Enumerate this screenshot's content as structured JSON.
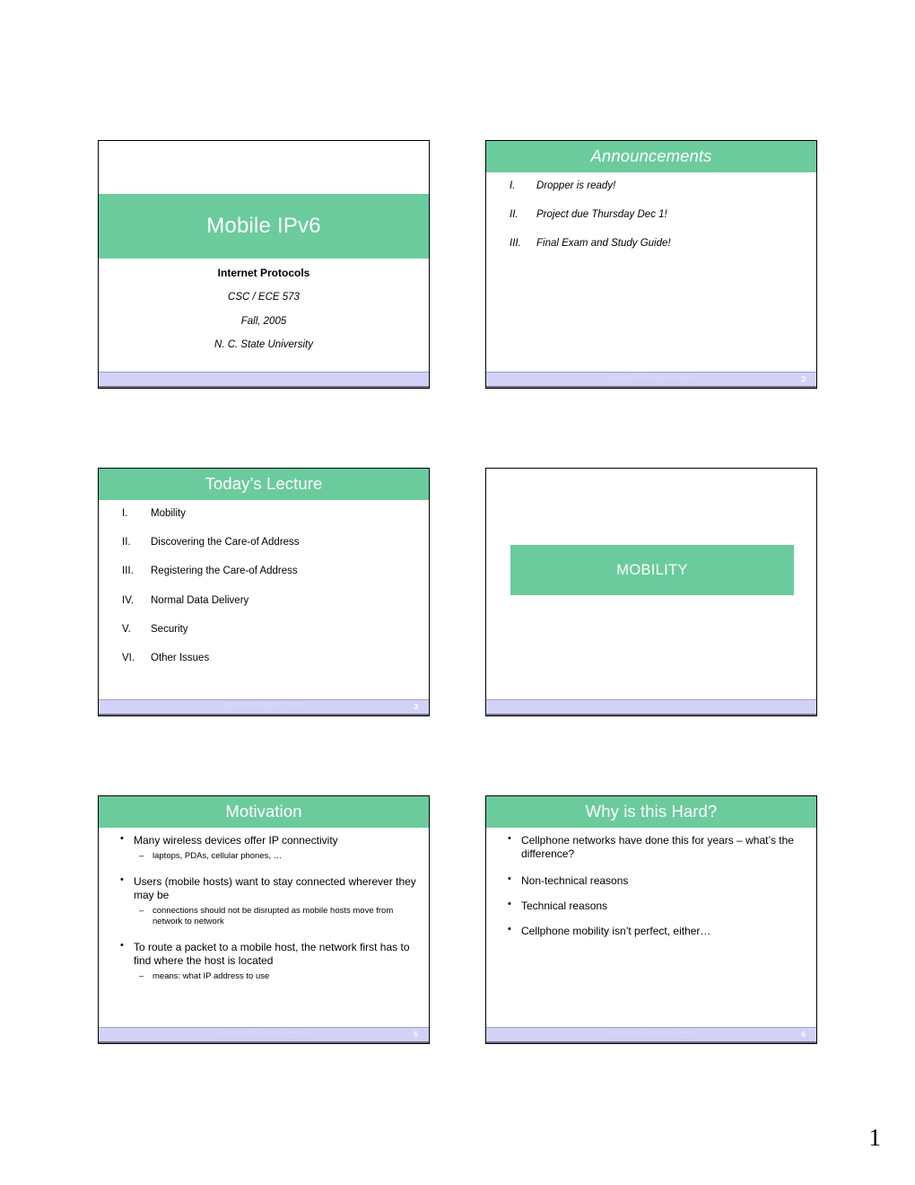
{
  "document": {
    "sheet_page_number": "1",
    "footer_copyright": "copyright 2005 Douglas S. Reeves",
    "accent_green": "#6BCB9D",
    "footer_bar_color": "#D2D2F7"
  },
  "slides": [
    {
      "id": "title-slide",
      "kind": "title",
      "band_title": "Mobile IPv6",
      "sub_lines": [
        "Internet Protocols",
        "CSC / ECE 573",
        "Fall, 2005",
        "N. C. State University"
      ],
      "footer": {
        "copyright": "",
        "page": ""
      }
    },
    {
      "id": "announcements-slide",
      "kind": "roman",
      "title": "Announcements",
      "items": [
        {
          "num": "I.",
          "text": "Dropper is ready!"
        },
        {
          "num": "II.",
          "text": "Project due Thursday Dec 1!"
        },
        {
          "num": "III.",
          "text": "Final Exam and Study Guide!"
        }
      ],
      "footer": {
        "copyright": "copyright 2005 Douglas S. Reeves",
        "page": "2"
      }
    },
    {
      "id": "todays-lecture-slide",
      "kind": "roman",
      "title": "Today’s Lecture",
      "items": [
        {
          "num": "I.",
          "text": "Mobility"
        },
        {
          "num": "II.",
          "text": "Discovering the Care-of Address"
        },
        {
          "num": "III.",
          "text": "Registering the Care-of Address"
        },
        {
          "num": "IV.",
          "text": "Normal Data Delivery"
        },
        {
          "num": "V.",
          "text": "Security"
        },
        {
          "num": "VI.",
          "text": "Other Issues"
        }
      ],
      "footer": {
        "copyright": "copyright 2005 Douglas S. Reeves",
        "page": "3"
      }
    },
    {
      "id": "mobility-section-slide",
      "kind": "section",
      "section_title": "MOBILITY",
      "footer": {
        "copyright": "",
        "page": ""
      }
    },
    {
      "id": "motivation-slide",
      "kind": "bullets",
      "title": "Motivation",
      "bullets": [
        {
          "level": 1,
          "text": "Many wireless devices offer IP connectivity"
        },
        {
          "level": 2,
          "text": "laptops, PDAs, cellular phones, …"
        },
        {
          "level": 1,
          "text": "Users (mobile hosts) want to stay connected wherever they may be"
        },
        {
          "level": 2,
          "text": "connections should not be disrupted as mobile hosts move from network to network"
        },
        {
          "level": 1,
          "text": "To route a packet to a mobile host, the network first has to find where the host is located"
        },
        {
          "level": 2,
          "text": "means: what IP address to use"
        }
      ],
      "footer": {
        "copyright": "copyright 2005 Douglas S. Reeves",
        "page": "5"
      }
    },
    {
      "id": "why-is-this-hard-slide",
      "kind": "bullets",
      "title": "Why is this Hard?",
      "bullets": [
        {
          "level": 1,
          "text": "Cellphone networks have done this for years – what’s the difference?"
        },
        {
          "level": 1,
          "text": "Non-technical reasons"
        },
        {
          "level": 1,
          "text": "Technical reasons"
        },
        {
          "level": 1,
          "text": "Cellphone mobility isn’t perfect, either…"
        }
      ],
      "footer": {
        "copyright": "copyright 2005 Douglas S. Reeves",
        "page": "6"
      }
    }
  ]
}
